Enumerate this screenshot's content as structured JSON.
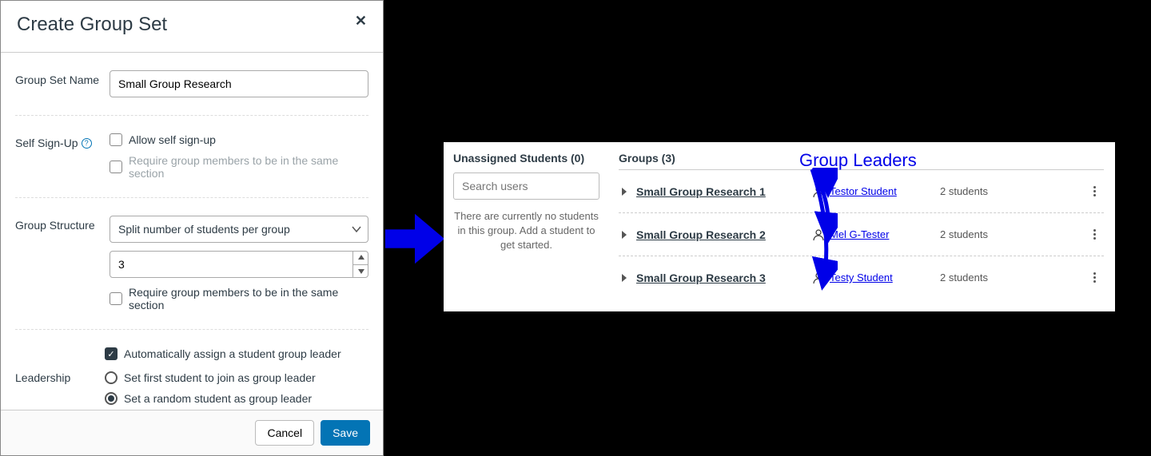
{
  "dialog": {
    "title": "Create Group Set",
    "sections": {
      "name": {
        "label": "Group Set Name",
        "value": "Small Group Research"
      },
      "signup": {
        "label": "Self Sign-Up",
        "allow_label": "Allow self sign-up",
        "require_same_section_label": "Require group members to be in the same section",
        "allow_checked": false,
        "require_checked": false
      },
      "structure": {
        "label": "Group Structure",
        "mode_label": "Split number of students per group",
        "count_value": "3",
        "require_same_section_label": "Require group members to be in the same section",
        "require_checked": false
      },
      "leadership": {
        "label": "Leadership",
        "auto_label": "Automatically assign a student group leader",
        "auto_checked": true,
        "radio_first_label": "Set first student to join as group leader",
        "radio_random_label": "Set a random student as group leader",
        "selected": "random"
      }
    },
    "footer": {
      "cancel": "Cancel",
      "save": "Save"
    }
  },
  "groups_panel": {
    "unassigned": {
      "heading": "Unassigned Students (0)",
      "search_placeholder": "Search users",
      "empty": "There are currently no students in this group. Add a student to get started."
    },
    "groups_heading": "Groups (3)",
    "groups": [
      {
        "name": "Small Group Research 1",
        "leader": "Testor Student",
        "count": "2 students"
      },
      {
        "name": "Small Group Research 2",
        "leader": "Mel G-Tester",
        "count": "2 students"
      },
      {
        "name": "Small Group Research 3",
        "leader": "Testy Student",
        "count": "2 students"
      }
    ]
  },
  "annotation": {
    "label": "Group Leaders"
  }
}
